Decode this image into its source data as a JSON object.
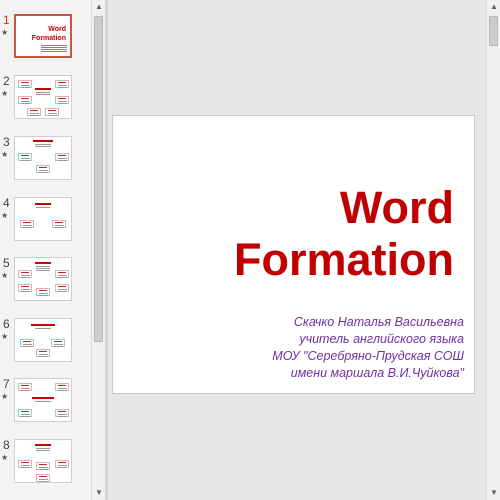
{
  "thumbnails": [
    {
      "number": "1",
      "star": "★",
      "title_lines": [
        "Word",
        "Formation"
      ],
      "selected": true
    },
    {
      "number": "2",
      "star": "★"
    },
    {
      "number": "3",
      "star": "★"
    },
    {
      "number": "4",
      "star": "★"
    },
    {
      "number": "5",
      "star": "★"
    },
    {
      "number": "6",
      "star": "★"
    },
    {
      "number": "7",
      "star": "★"
    },
    {
      "number": "8",
      "star": "★"
    }
  ],
  "scrollbar": {
    "up_arrow": "▲",
    "down_arrow": "▼"
  },
  "slide": {
    "title_line1": "Word",
    "title_line2": "Formation",
    "subtitle": [
      "Скачко Наталья Васильевна",
      "учитель английского языка",
      "МОУ \"Серебряно-Прудская СОШ",
      "имени маршала В.И.Чуйкова\""
    ]
  },
  "colors": {
    "title": "#c00000",
    "subtitle": "#7030a0",
    "selection_border": "#c65a3f"
  }
}
